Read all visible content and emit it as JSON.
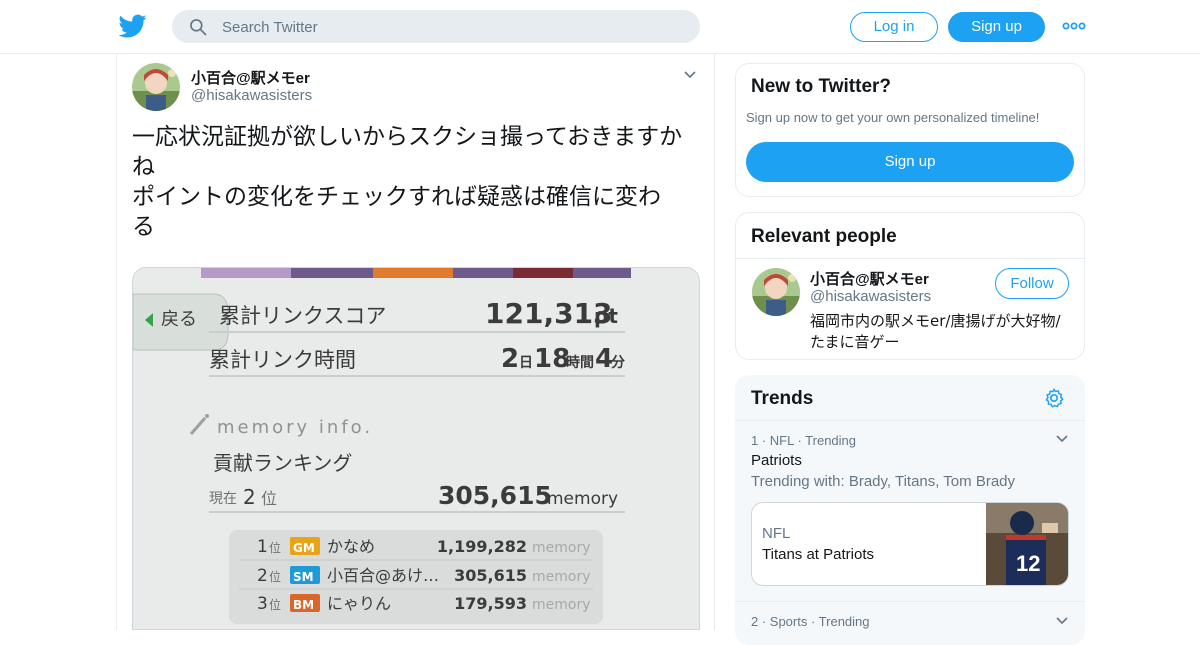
{
  "header": {
    "logo": "twitter-bird-icon",
    "search_placeholder": "Search Twitter",
    "login_label": "Log in",
    "signup_label": "Sign up",
    "more_icon": "more-dots-icon"
  },
  "tweet": {
    "name": "小百合@駅メモer",
    "handle": "@hisakawasisters",
    "lines": [
      "一応状況証拠が欲しいからスクショ撮っておきますか",
      "ね",
      "ポイントの変化をチェックすれば疑惑は確信に変わ",
      "る"
    ],
    "media": {
      "back_label": "戻る",
      "link_score_label": "累計リンクスコア",
      "link_score_value": "121,313",
      "link_score_unit": "pt",
      "link_time_label": "累計リンク時間",
      "link_time_d": "2",
      "link_time_d_unit": "日",
      "link_time_h": "18",
      "link_time_h_unit": "時間",
      "link_time_m": "4",
      "link_time_m_unit": "分",
      "memory_info": "memory info.",
      "ranking_title": "貢献ランキング",
      "current_label": "現在",
      "current_rank": "2",
      "current_rank_unit": "位",
      "current_memory": "305,615",
      "memory_unit": "memory",
      "ranking": [
        {
          "rank": "1",
          "unit": "位",
          "badge": "GM",
          "badge_color": "#e8a317",
          "name": "かなめ",
          "value": "1,199,282"
        },
        {
          "rank": "2",
          "unit": "位",
          "badge": "SM",
          "badge_color": "#1f9ad6",
          "name": "小百合@あけ…",
          "value": "305,615"
        },
        {
          "rank": "3",
          "unit": "位",
          "badge": "BM",
          "badge_color": "#d9672b",
          "name": "にゃりん",
          "value": "179,593"
        }
      ]
    }
  },
  "sidebar": {
    "new_to_twitter": {
      "title": "New to Twitter?",
      "text": "Sign up now to get your own personalized timeline!",
      "button": "Sign up"
    },
    "relevant": {
      "title": "Relevant people",
      "name": "小百合@駅メモer",
      "handle": "@hisakawasisters",
      "follow_label": "Follow",
      "bio_lines": [
        "福岡市内の駅メモer/唐揚げが大好物/",
        "たまに音ゲー"
      ]
    },
    "trends": {
      "title": "Trends",
      "items": [
        {
          "meta": "1 · NFL · Trending",
          "title": "Patriots",
          "with": "Trending with: Brady, Titans, Tom Brady",
          "card": {
            "category": "NFL",
            "event": "Titans at Patriots"
          }
        },
        {
          "meta": "2 · Sports · Trending"
        }
      ]
    }
  },
  "colors": {
    "accent": "#1da1f2",
    "text": "#14171a",
    "secondary": "#657786",
    "border": "#e6ecf0"
  }
}
